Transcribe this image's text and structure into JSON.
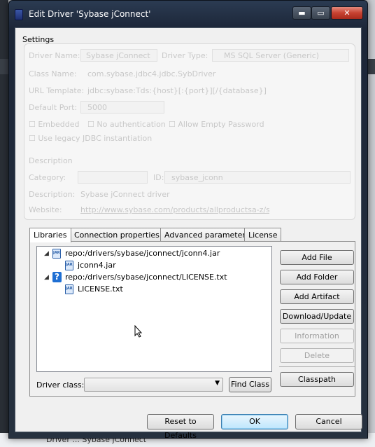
{
  "background": {
    "bottom_text": "Driver ... Sybase jConnect"
  },
  "window": {
    "title": "Edit Driver 'Sybase jConnect'",
    "controls": {
      "minimize": "▬",
      "maximize": "▭",
      "close": "✕"
    }
  },
  "settings": {
    "label": "Settings",
    "faded": {
      "driver_name_label": "Driver Name:",
      "driver_name_value": "Sybase jConnect",
      "driver_type_label": "Driver Type:",
      "driver_type_value": "MS SQL Server (Generic)",
      "class_name_label": "Class Name:",
      "class_name_value": "com.sybase.jdbc4.jdbc.SybDriver",
      "url_template_label": "URL Template:",
      "url_template_value": "jdbc:sybase:Tds:{host}[:{port}][/{database}]",
      "default_port_label": "Default Port:",
      "default_port_value": "5000",
      "embedded_label": "Embedded",
      "no_auth_label": "No authentication",
      "allow_empty_password_label": "Allow Empty Password",
      "legacy_jdbc_label": "Use legacy JDBC instantiation",
      "description_section": "Description",
      "category_label": "Category:",
      "id_label": "ID:",
      "id_value": "sybase_jconn",
      "description_label": "Description:",
      "description_value": "Sybase jConnect driver",
      "website_label": "Website:",
      "website_value": "http://www.sybase.com/products/allproductsa-z/softwaredeveloperkit/jconnect"
    }
  },
  "tabs": [
    "Libraries",
    "Connection properties",
    "Advanced parameters",
    "License"
  ],
  "tree": [
    {
      "label": "repo:/drivers/sybase/jconnect/jconn4.jar",
      "icon": "jar-icon"
    },
    {
      "label": "jconn4.jar",
      "icon": "jar-icon"
    },
    {
      "label": "repo:/drivers/sybase/jconnect/LICENSE.txt",
      "icon": "help-icon"
    },
    {
      "label": "LICENSE.txt",
      "icon": "jar-icon"
    }
  ],
  "buttons": {
    "add_file": "Add File",
    "add_folder": "Add Folder",
    "add_artifact": "Add Artifact",
    "download_update": "Download/Update",
    "information": "Information",
    "delete": "Delete",
    "classpath": "Classpath"
  },
  "driver_class": {
    "label": "Driver class:",
    "value": "",
    "find_button": "Find Class"
  },
  "footer": {
    "reset": "Reset to Defaults",
    "ok": "OK",
    "cancel": "Cancel"
  }
}
